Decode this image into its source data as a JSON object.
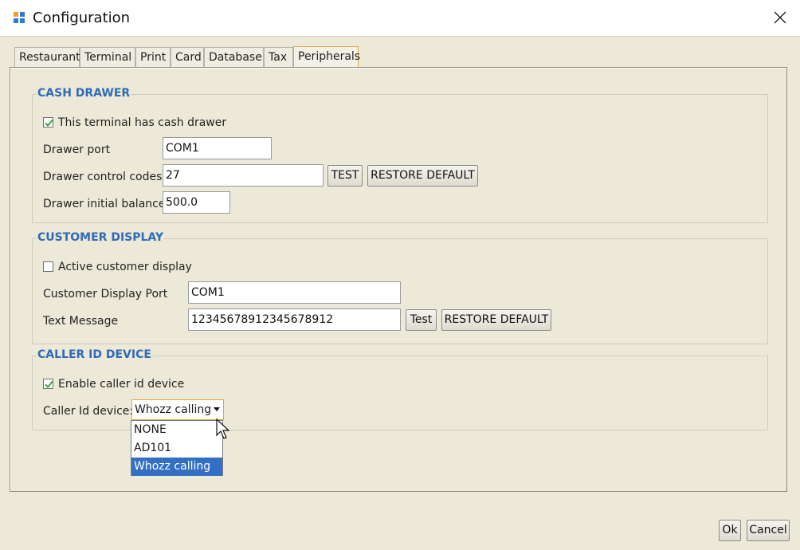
{
  "window": {
    "title": "Configuration",
    "icon": "app-icon",
    "close": "close-icon"
  },
  "tabs": [
    {
      "label": "Restaurant"
    },
    {
      "label": "Terminal"
    },
    {
      "label": "Print"
    },
    {
      "label": "Card"
    },
    {
      "label": "Database"
    },
    {
      "label": "Tax"
    },
    {
      "label": "Peripherals",
      "active": true
    }
  ],
  "cash_drawer": {
    "title": "CASH DRAWER",
    "has_drawer": {
      "label": "This terminal has cash drawer",
      "checked": true
    },
    "port": {
      "label": "Drawer port",
      "value": "COM1"
    },
    "control_codes": {
      "label": "Drawer control codes",
      "value": "27",
      "test_label": "TEST",
      "restore_label": "RESTORE DEFAULT"
    },
    "initial_balance": {
      "label": "Drawer initial balance",
      "value": "500.0"
    }
  },
  "customer_display": {
    "title": "CUSTOMER DISPLAY",
    "active": {
      "label": "Active customer display",
      "checked": false
    },
    "port": {
      "label": "Customer Display Port",
      "value": "COM1"
    },
    "text_message": {
      "label": "Text Message",
      "value": "12345678912345678912",
      "test_label": "Test",
      "restore_label": "RESTORE DEFAULT"
    }
  },
  "caller_id": {
    "title": "CALLER ID DEVICE",
    "enable": {
      "label": "Enable caller id device",
      "checked": true
    },
    "device": {
      "label": "Caller Id device:",
      "selected": "Whozz calling",
      "options": [
        "NONE",
        "AD101",
        "Whozz calling"
      ]
    }
  },
  "footer": {
    "ok_label": "Ok",
    "cancel_label": "Cancel"
  },
  "colors": {
    "accent": "#2f6bb7",
    "selection": "#3370c4",
    "focus": "#e2a93b",
    "background": "#ece9d8"
  }
}
